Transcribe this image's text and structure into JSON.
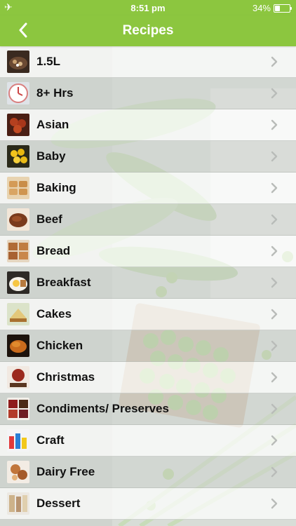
{
  "status": {
    "time": "8:51 pm",
    "battery": "34%",
    "battery_fraction": 0.34
  },
  "nav": {
    "title": "Recipes"
  },
  "categories": [
    {
      "label": "1.5L",
      "icon": "slow-cooker-pot-thumbnail"
    },
    {
      "label": "8+ Hrs",
      "icon": "clock-thumbnail"
    },
    {
      "label": "Asian",
      "icon": "asian-dish-thumbnail"
    },
    {
      "label": "Baby",
      "icon": "baby-food-thumbnail"
    },
    {
      "label": "Baking",
      "icon": "baking-thumbnail"
    },
    {
      "label": "Beef",
      "icon": "beef-thumbnail"
    },
    {
      "label": "Bread",
      "icon": "bread-thumbnail"
    },
    {
      "label": "Breakfast",
      "icon": "breakfast-thumbnail"
    },
    {
      "label": "Cakes",
      "icon": "cake-thumbnail"
    },
    {
      "label": "Chicken",
      "icon": "roast-chicken-thumbnail"
    },
    {
      "label": "Christmas",
      "icon": "christmas-thumbnail"
    },
    {
      "label": "Condiments/ Preserves",
      "icon": "preserves-thumbnail"
    },
    {
      "label": "Craft",
      "icon": "craft-thumbnail"
    },
    {
      "label": "Dairy Free",
      "icon": "dairy-free-thumbnail"
    },
    {
      "label": "Dessert",
      "icon": "dessert-thumbnail"
    }
  ],
  "colors": {
    "accent": "#8cc63f",
    "chevron": "#b9bcb9"
  }
}
